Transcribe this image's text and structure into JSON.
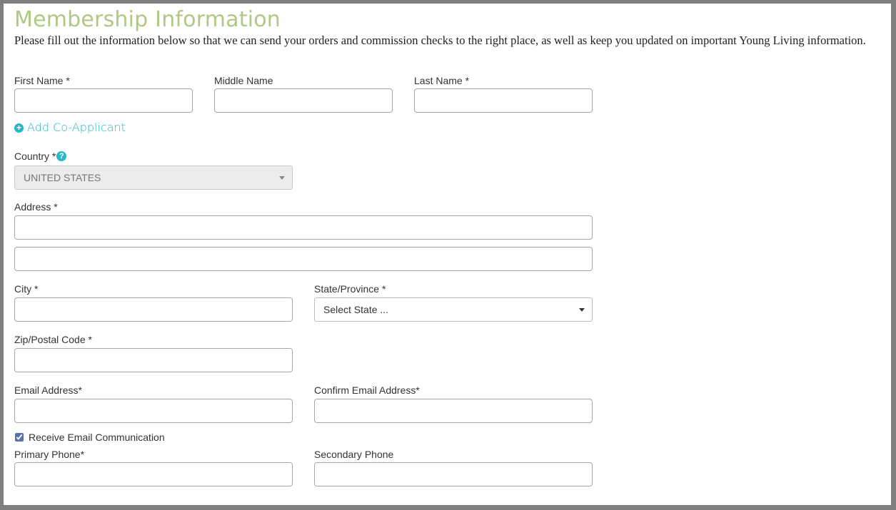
{
  "page": {
    "title": "Membership Information",
    "intro": "Please fill out the information below so that we can send your orders and commission checks to the right place, as well as keep you updated on important Young Living information."
  },
  "colors": {
    "title": "#afc883",
    "accent": "#29b6c6",
    "frame": "#7f7f7f"
  },
  "fields": {
    "first_name": {
      "label": "First Name *",
      "value": ""
    },
    "middle_name": {
      "label": "Middle Name",
      "value": ""
    },
    "last_name": {
      "label": "Last Name *",
      "value": ""
    },
    "add_co_applicant": {
      "label": "Add Co-Applicant",
      "icon": "plus-circle-icon"
    },
    "country": {
      "label": "Country *",
      "help_icon": "?",
      "value": "UNITED STATES",
      "disabled": true
    },
    "address": {
      "label": "Address *",
      "line1": "",
      "line2": ""
    },
    "city": {
      "label": "City *",
      "value": ""
    },
    "state": {
      "label": "State/Province *",
      "value": "Select State ..."
    },
    "zip": {
      "label": "Zip/Postal Code *",
      "value": ""
    },
    "email": {
      "label": "Email Address*",
      "value": ""
    },
    "confirm_email": {
      "label": "Confirm Email Address*",
      "value": ""
    },
    "receive_email": {
      "label": "Receive Email Communication",
      "checked": true
    },
    "primary_phone": {
      "label": "Primary Phone*",
      "value": ""
    },
    "secondary_phone": {
      "label": "Secondary Phone",
      "value": ""
    }
  }
}
